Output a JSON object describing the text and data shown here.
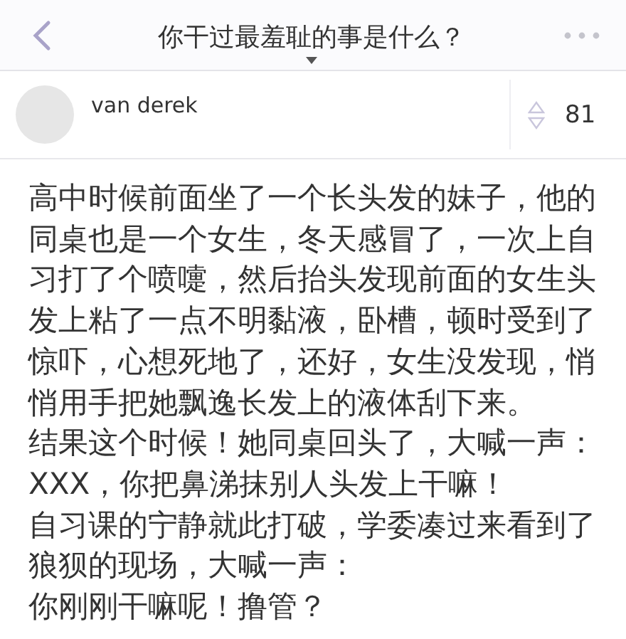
{
  "header": {
    "title": "你干过最羞耻的事是什么？"
  },
  "answer": {
    "author": "van derek",
    "votes": "81",
    "paragraphs": [
      "高中时候前面坐了一个长头发的妹子，他的同桌也是一个女生，冬天感冒了，一次上自习打了个喷嚏，然后抬头发现前面的女生头发上粘了一点不明黏液，卧槽，顿时受到了惊吓，心想死地了，还好，女生没发现，悄悄用手把她飘逸长发上的液体刮下来。",
      "结果这个时候！她同桌回头了，大喊一声：",
      "XXX，你把鼻涕抹别人头发上干嘛！",
      "自习课的宁静就此打破，学委凑过来看到了狼狈的现场，大喊一声：",
      "你刚刚干嘛呢！撸管？"
    ]
  }
}
